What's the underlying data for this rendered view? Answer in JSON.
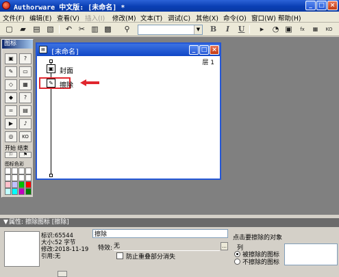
{
  "app": {
    "title": "Authorware 中文版: [未命名] *",
    "window_buttons": {
      "minimize": "_",
      "maximize": "□",
      "close": "×"
    }
  },
  "menu": [
    {
      "label": "文件(F)",
      "enabled": true
    },
    {
      "label": "编辑(E)",
      "enabled": true
    },
    {
      "label": "查看(V)",
      "enabled": true
    },
    {
      "label": "插入(I)",
      "enabled": false
    },
    {
      "label": "修改(M)",
      "enabled": true
    },
    {
      "label": "文本(T)",
      "enabled": true
    },
    {
      "label": "调试(C)",
      "enabled": true
    },
    {
      "label": "其他(X)",
      "enabled": true
    },
    {
      "label": "命令(O)",
      "enabled": true
    },
    {
      "label": "窗口(W)",
      "enabled": true
    },
    {
      "label": "帮助(H)",
      "enabled": true
    }
  ],
  "toolbar": {
    "font_value": "",
    "bold": "B",
    "italic": "I",
    "underline": "U",
    "icons": [
      "new-icon",
      "open-icon",
      "save-all-icon",
      "import-icon",
      "undo-icon",
      "cut-icon",
      "copy-icon",
      "paste-icon",
      "find-icon",
      "bold-icon",
      "italic-icon",
      "underline-icon",
      "restart-icon",
      "restart-from-flag-icon",
      "control-panel-icon",
      "functions-icon",
      "variables-icon",
      "knowledge-objects-icon"
    ]
  },
  "palette": {
    "title": "图标",
    "icons": [
      {
        "name": "display-icon",
        "glyph": "▣"
      },
      {
        "name": "motion-icon",
        "glyph": "?"
      },
      {
        "name": "erase-icon",
        "glyph": "✎"
      },
      {
        "name": "wait-icon",
        "glyph": "▭"
      },
      {
        "name": "navigate-icon",
        "glyph": "◇"
      },
      {
        "name": "framework-icon",
        "glyph": "▦"
      },
      {
        "name": "decision-icon",
        "glyph": "◆"
      },
      {
        "name": "interaction-icon",
        "glyph": "?"
      },
      {
        "name": "calculation-icon",
        "glyph": "="
      },
      {
        "name": "map-icon",
        "glyph": "▤"
      },
      {
        "name": "movie-icon",
        "glyph": "▶"
      },
      {
        "name": "sound-icon",
        "glyph": "♪"
      },
      {
        "name": "video-icon",
        "glyph": "◎"
      },
      {
        "name": "knowledge-object-icon",
        "glyph": "KO"
      }
    ],
    "flags_label": "开始 结束",
    "color_label": "图标色彩",
    "colors": [
      "#ffffff",
      "#ffffff",
      "#ffffff",
      "#ffffff",
      "#ffffff",
      "#ffffff",
      "#ffffff",
      "#ffffff",
      "#ffc0cb",
      "#c0c0ff",
      "#00c000",
      "#ff0000",
      "#c0ffff",
      "#00ffff",
      "#c000c0",
      "#008000"
    ]
  },
  "flow_window": {
    "title": "[未命名]",
    "layer_label": "层 1",
    "icons": [
      {
        "label": "封面",
        "glyph": "▣",
        "name": "cover-display-icon"
      },
      {
        "label": "擦除",
        "glyph": "✎",
        "name": "erase-flow-icon"
      }
    ]
  },
  "properties": {
    "header": "属性: 擦除图标 [擦除]",
    "id_line": "标识:65544",
    "size_line": "大小:52 字节",
    "modified_line": "修改:2018-11-19",
    "ref_line": "引用:无",
    "name_value": "擦除",
    "effect_label": "特效:",
    "effect_value": "无",
    "prevent_label": "防止重叠部分消失",
    "prevent_checked": false,
    "click_hint": "点击要擦除的对象",
    "list_label": "列",
    "radio_erase": "被擦除的图标",
    "radio_keep": "不擦除的图标",
    "selected_radio": "erase"
  }
}
